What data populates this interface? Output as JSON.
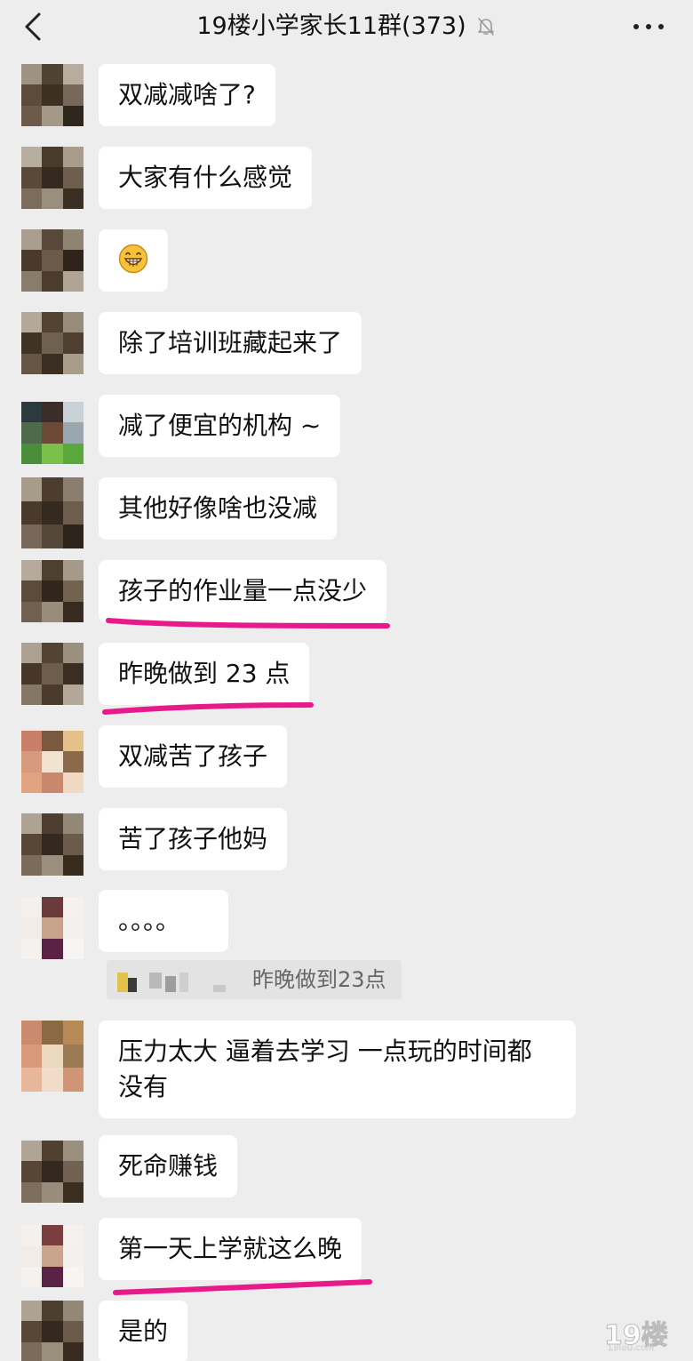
{
  "header": {
    "title": "19楼小学家长11群(373)",
    "back_icon": "chevron-left-icon",
    "mute_icon": "bell-slash-icon",
    "more_icon": "more-dots-icon"
  },
  "messages": [
    {
      "text": "双减减啥了?"
    },
    {
      "text": "大家有什么感觉"
    },
    {
      "text": "",
      "emoji": "grin-face-emoji"
    },
    {
      "text": "除了培训班藏起来了"
    },
    {
      "text": "减了便宜的机构 ~"
    },
    {
      "text": "其他好像啥也没减"
    },
    {
      "text": "孩子的作业量一点没少",
      "highlighted": true
    },
    {
      "text": "昨晚做到 23 点",
      "highlighted": true
    },
    {
      "text": "双减苦了孩子"
    },
    {
      "text": "苦了孩子他妈"
    },
    {
      "text": "。。。。"
    },
    {
      "text": "压力太大 逼着去学习 一点玩的时间都没有"
    },
    {
      "text": "死命赚钱"
    },
    {
      "text": "第一天上学就这么晚",
      "highlighted": true
    },
    {
      "text": "是的"
    }
  ],
  "quote": {
    "text": "昨晚做到23点"
  },
  "watermark": {
    "number": "19",
    "char": "楼",
    "domain": "19lou.com"
  },
  "colors": {
    "background": "#ededed",
    "bubble": "#ffffff",
    "highlight_underline": "#e8198b"
  }
}
